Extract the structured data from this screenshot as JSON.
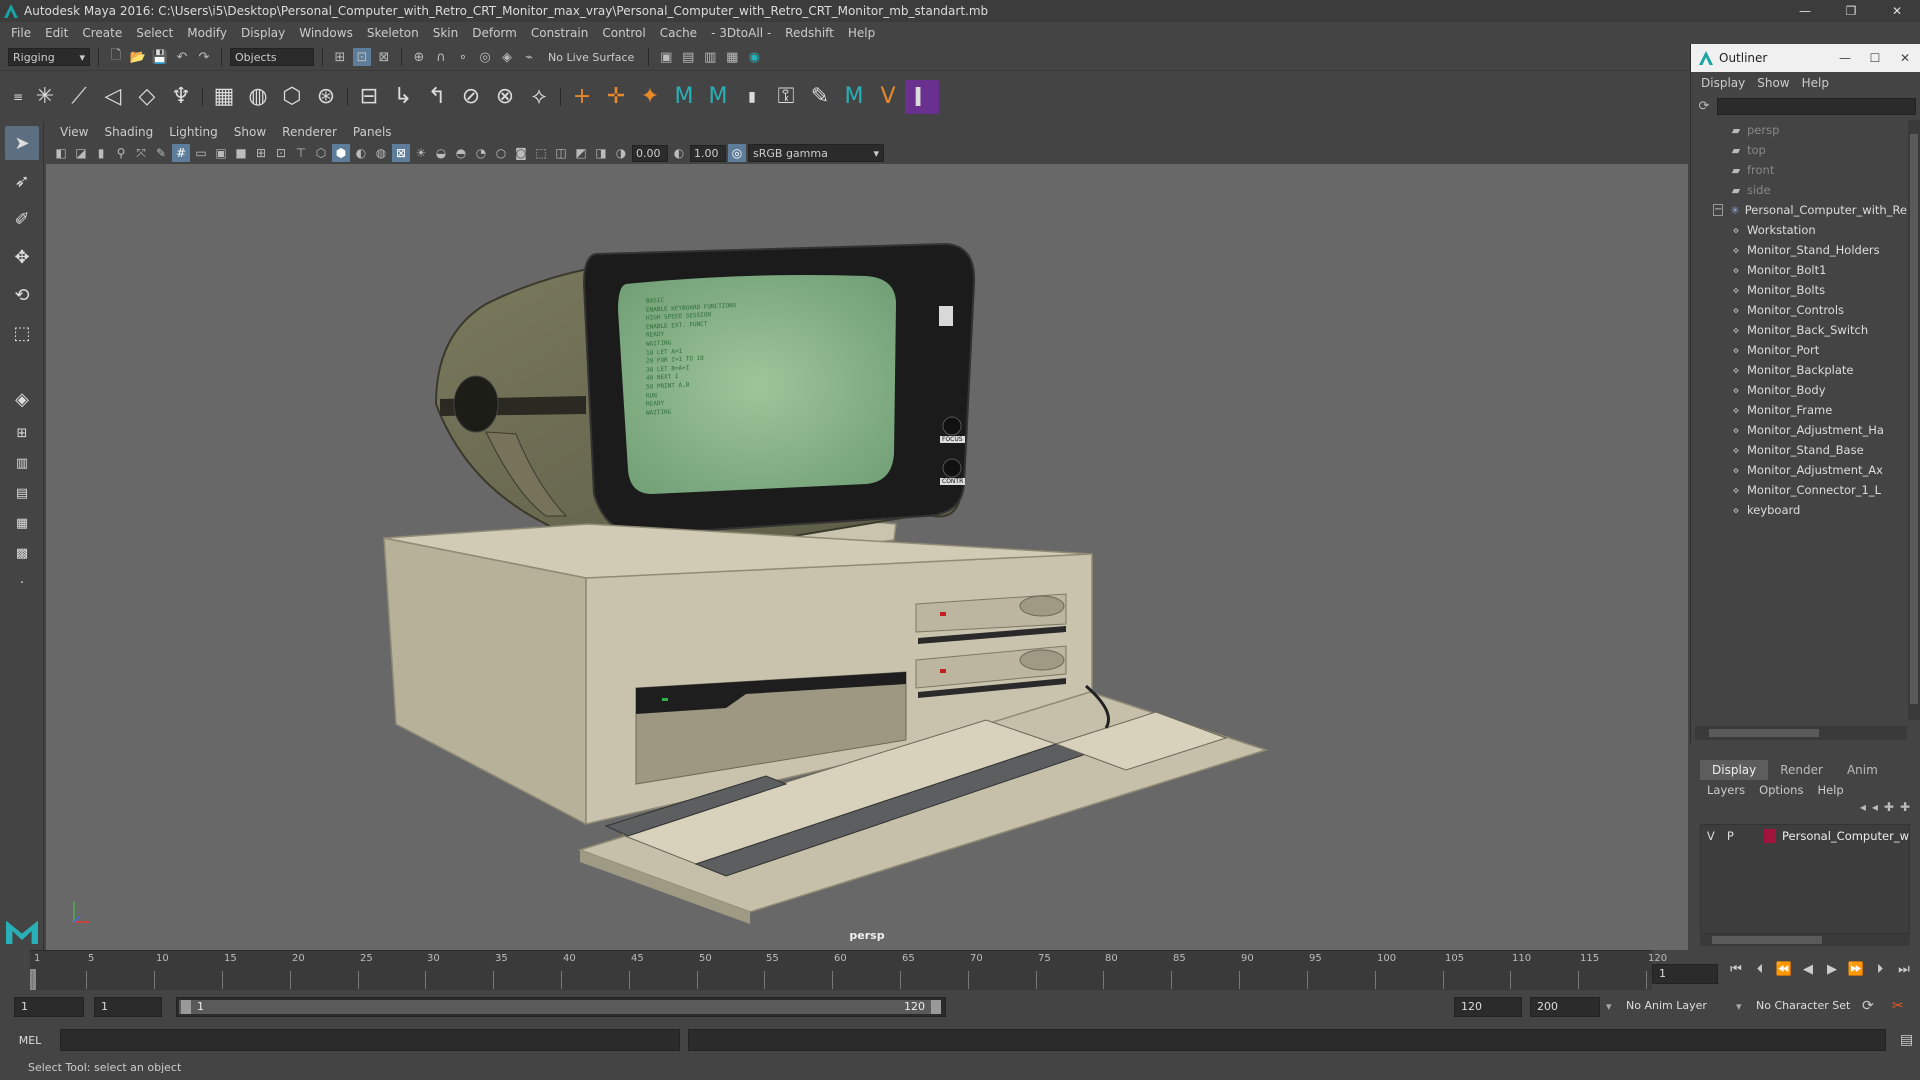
{
  "window": {
    "title": "Autodesk Maya 2016: C:\\Users\\i5\\Desktop\\Personal_Computer_with_Retro_CRT_Monitor_max_vray\\Personal_Computer_with_Retro_CRT_Monitor_mb_standart.mb",
    "minimize": "—",
    "maximize": "❐",
    "close": "✕"
  },
  "menu": [
    "File",
    "Edit",
    "Create",
    "Select",
    "Modify",
    "Display",
    "Windows",
    "Skeleton",
    "Skin",
    "Deform",
    "Constrain",
    "Control",
    "Cache",
    "- 3DtoAll -",
    "Redshift",
    "Help"
  ],
  "statusline": {
    "menuset": "Rigging",
    "select_mode": "Objects",
    "live_surface": "No Live Surface"
  },
  "panel": {
    "menu": [
      "View",
      "Shading",
      "Lighting",
      "Show",
      "Renderer",
      "Panels"
    ],
    "exposure": "0.00",
    "gamma": "1.00",
    "colorspace": "sRGB gamma",
    "camera": "persp"
  },
  "outliner": {
    "title": "Outliner",
    "menu": [
      "Display",
      "Show",
      "Help"
    ],
    "cameras": [
      "persp",
      "top",
      "front",
      "side"
    ],
    "root": "Personal_Computer_with_Re",
    "children": [
      "Workstation",
      "Monitor_Stand_Holders",
      "Monitor_Bolt1",
      "Monitor_Bolts",
      "Monitor_Controls",
      "Monitor_Back_Switch",
      "Monitor_Port",
      "Monitor_Backplate",
      "Monitor_Body",
      "Monitor_Frame",
      "Monitor_Adjustment_Ha",
      "Monitor_Stand_Base",
      "Monitor_Adjustment_Ax",
      "Monitor_Connector_1_L",
      "keyboard"
    ]
  },
  "layer_editor": {
    "tabs": [
      "Display",
      "Render",
      "Anim"
    ],
    "menu": [
      "Layers",
      "Options",
      "Help"
    ],
    "layer": {
      "v": "V",
      "p": "P",
      "name": "Personal_Computer_w",
      "color": "#a0143c"
    }
  },
  "timeline": {
    "ticks": [
      "1",
      "5",
      "10",
      "15",
      "20",
      "25",
      "30",
      "35",
      "40",
      "45",
      "50",
      "55",
      "60",
      "65",
      "70",
      "75",
      "80",
      "85",
      "90",
      "95",
      "100",
      "105",
      "110",
      "115",
      "120"
    ],
    "current_frame": "1",
    "range_start": "1",
    "playback_start": "1",
    "range_bar_start": "1",
    "range_bar_end": "120",
    "playback_end": "120",
    "range_end": "200",
    "anim_layer": "No Anim Layer",
    "character_set": "No Character Set"
  },
  "command": {
    "label": "MEL"
  },
  "help_line": "Select Tool: select an object",
  "screen_text": [
    "BASIC",
    "ENABLE KEYBOARD FUNCTIONS",
    "HIGH SPEED SESSION",
    "ENABLE EXT. FUNCT",
    "READY",
    "WAITING",
    "10 LET A=1",
    "20 FOR I=1 TO 10",
    "30 LET B=A+I",
    "40 NEXT I",
    "50 PRINT A,B",
    "RUN",
    "READY",
    "WAITING"
  ],
  "monitor_buttons": [
    "FOCUS",
    "CONTR"
  ]
}
